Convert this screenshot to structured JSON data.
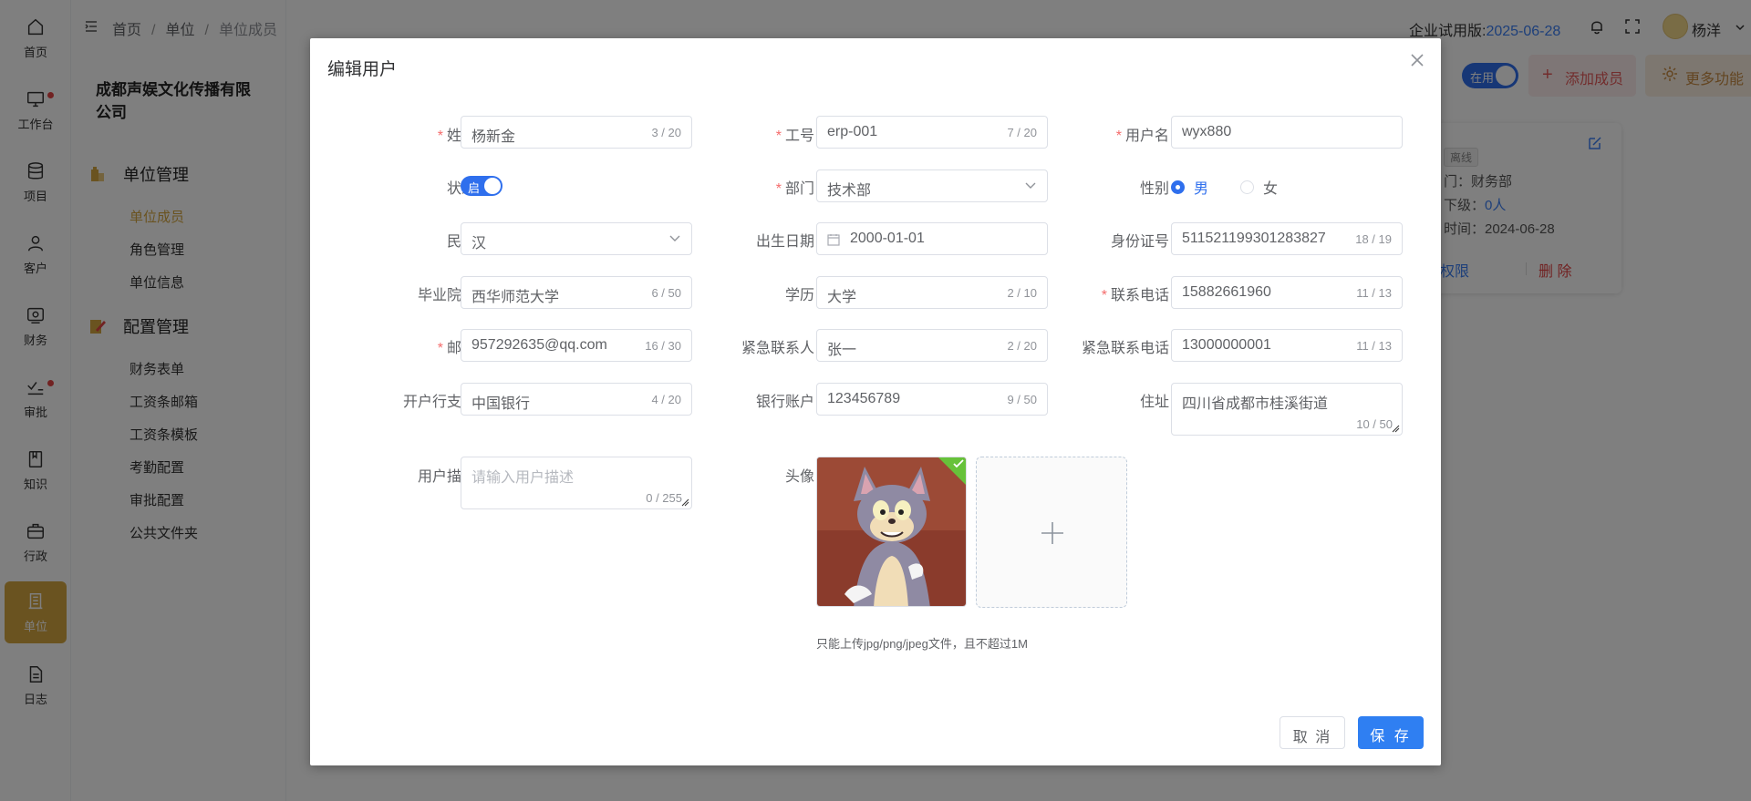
{
  "rail": [
    {
      "icon": "home-icon",
      "label": "首页"
    },
    {
      "icon": "monitor-icon",
      "label": "工作台",
      "dot": true
    },
    {
      "icon": "database-icon",
      "label": "项目"
    },
    {
      "icon": "user-icon",
      "label": "客户"
    },
    {
      "icon": "wallet-icon",
      "label": "财务"
    },
    {
      "icon": "approval-icon",
      "label": "审批",
      "dot": true
    },
    {
      "icon": "book-icon",
      "label": "知识"
    },
    {
      "icon": "briefcase-icon",
      "label": "行政"
    },
    {
      "icon": "building-icon",
      "label": "单位",
      "active": true
    },
    {
      "icon": "document-icon",
      "label": "日志"
    }
  ],
  "submenu": {
    "company": "成都声娱文化传播有限公司",
    "group1": "单位管理",
    "group1_items": [
      "单位成员",
      "角色管理",
      "单位信息"
    ],
    "group2": "配置管理",
    "group2_items": [
      "财务表单",
      "工资条邮箱",
      "工资条模板",
      "考勤配置",
      "审批配置",
      "公共文件夹"
    ]
  },
  "topbar": {
    "breadcrumb": [
      "首页",
      "单位",
      "单位成员"
    ],
    "trial_label": "企业试用版:",
    "trial_date": "2025-06-28",
    "user": "杨洋"
  },
  "background": {
    "status_toggle": "在用",
    "add_member": "添加成员",
    "more_functions": "更多功能",
    "card": {
      "badge": "离线",
      "dept": "门：财务部",
      "sub_label": "下级：",
      "sub_value": "0人",
      "time": "时间：2024-06-28",
      "perm": "权限",
      "delete": "删 除"
    }
  },
  "dialog": {
    "title": "编辑用户",
    "fields": {
      "name": {
        "label": "姓名",
        "value": "杨新金",
        "count": "3 / 20"
      },
      "jobno": {
        "label": "工号",
        "value": "erp-001",
        "count": "7 / 20"
      },
      "username": {
        "label": "用户名",
        "value": "wyx880"
      },
      "status": {
        "label": "状态",
        "switch_text": "启"
      },
      "dept": {
        "label": "部门",
        "value": "技术部"
      },
      "gender": {
        "label": "性别",
        "male": "男",
        "female": "女"
      },
      "ethnic": {
        "label": "民族",
        "value": "汉"
      },
      "birth": {
        "label": "出生日期",
        "value": "2000-01-01"
      },
      "idcard": {
        "label": "身份证号",
        "value": "511521199301283827",
        "count": "18 / 19"
      },
      "school": {
        "label": "毕业院校",
        "value": "西华师范大学",
        "count": "6 / 50"
      },
      "edu": {
        "label": "学历",
        "value": "大学",
        "count": "2 / 10"
      },
      "phone": {
        "label": "联系电话",
        "value": "15882661960",
        "count": "11 / 13"
      },
      "email": {
        "label": "邮箱",
        "value": "957292635@qq.com",
        "count": "16 / 30"
      },
      "emcontact": {
        "label": "紧急联系人",
        "value": "张一",
        "count": "2 / 20"
      },
      "emphone": {
        "label": "紧急联系电话",
        "value": "13000000001",
        "count": "11 / 13"
      },
      "bank": {
        "label": "开户行支行",
        "value": "中国银行",
        "count": "4 / 20"
      },
      "account": {
        "label": "银行账户",
        "value": "123456789",
        "count": "9 / 50"
      },
      "address": {
        "label": "住址",
        "value": "四川省成都市桂溪街道",
        "count": "10 / 50"
      },
      "desc": {
        "label": "用户描述",
        "placeholder": "请输入用户描述",
        "count": "0 / 255"
      },
      "avatar": {
        "label": "头像",
        "tip": "只能上传jpg/png/jpeg文件，且不超过1M"
      }
    },
    "cancel": "取 消",
    "save": "保 存"
  }
}
